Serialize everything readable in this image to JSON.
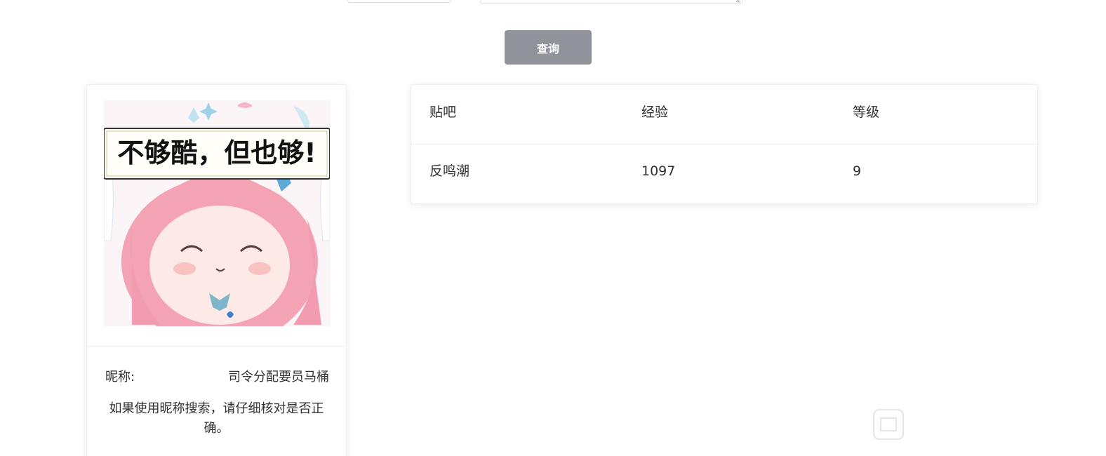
{
  "search": {
    "button_label": "查询"
  },
  "profile": {
    "banner_text": "不够酷，但也够!",
    "nickname_label": "昵称:",
    "nickname_value": "司令分配要员马桶",
    "note": "如果使用昵称搜索，请仔细核对是否正确。"
  },
  "table": {
    "headers": [
      "贴吧",
      "经验",
      "等级"
    ],
    "rows": [
      [
        "反鸣潮",
        "1097",
        "9"
      ]
    ]
  },
  "colors": {
    "button_bg": "#909399",
    "border": "#ebeef5",
    "hair": "#f4a3b5"
  },
  "icons": {
    "corner": "watermark-logo-icon"
  }
}
